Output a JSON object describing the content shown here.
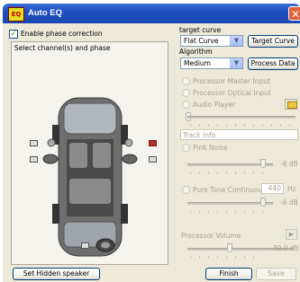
{
  "window": {
    "title": "Auto EQ",
    "logo_text": "EQ"
  },
  "left": {
    "enable_phase_label": "Enable phase correction",
    "enable_phase_checked": true,
    "select_channel_label": "Select channel(s) and phase",
    "set_hidden_speaker_label": "Set Hidden speaker"
  },
  "right": {
    "target_curve_label": "target curve",
    "target_curve_value": "Flat Curve",
    "target_curve_button": "Target Curve",
    "algorithm_label": "Algorithm",
    "algorithm_value": "Medium",
    "process_data_button": "Process Data",
    "sources": {
      "processor_master_input": "Processor Master Input",
      "processor_optical_input": "Processor Optical Input",
      "audio_player": "Audio Player",
      "track_info": "Track Info",
      "pink_noise": "Pink Noise",
      "pink_noise_level": "-6 dB",
      "pure_tone": "Pure Tone Continuous",
      "pure_tone_freq": "440",
      "pure_tone_unit": "Hz",
      "pure_tone_level": "-6 dB"
    },
    "processor_volume_label": "Processor Volume",
    "processor_volume_value": "-30.0 dB",
    "finish_button": "Finish",
    "save_button": "Save"
  }
}
